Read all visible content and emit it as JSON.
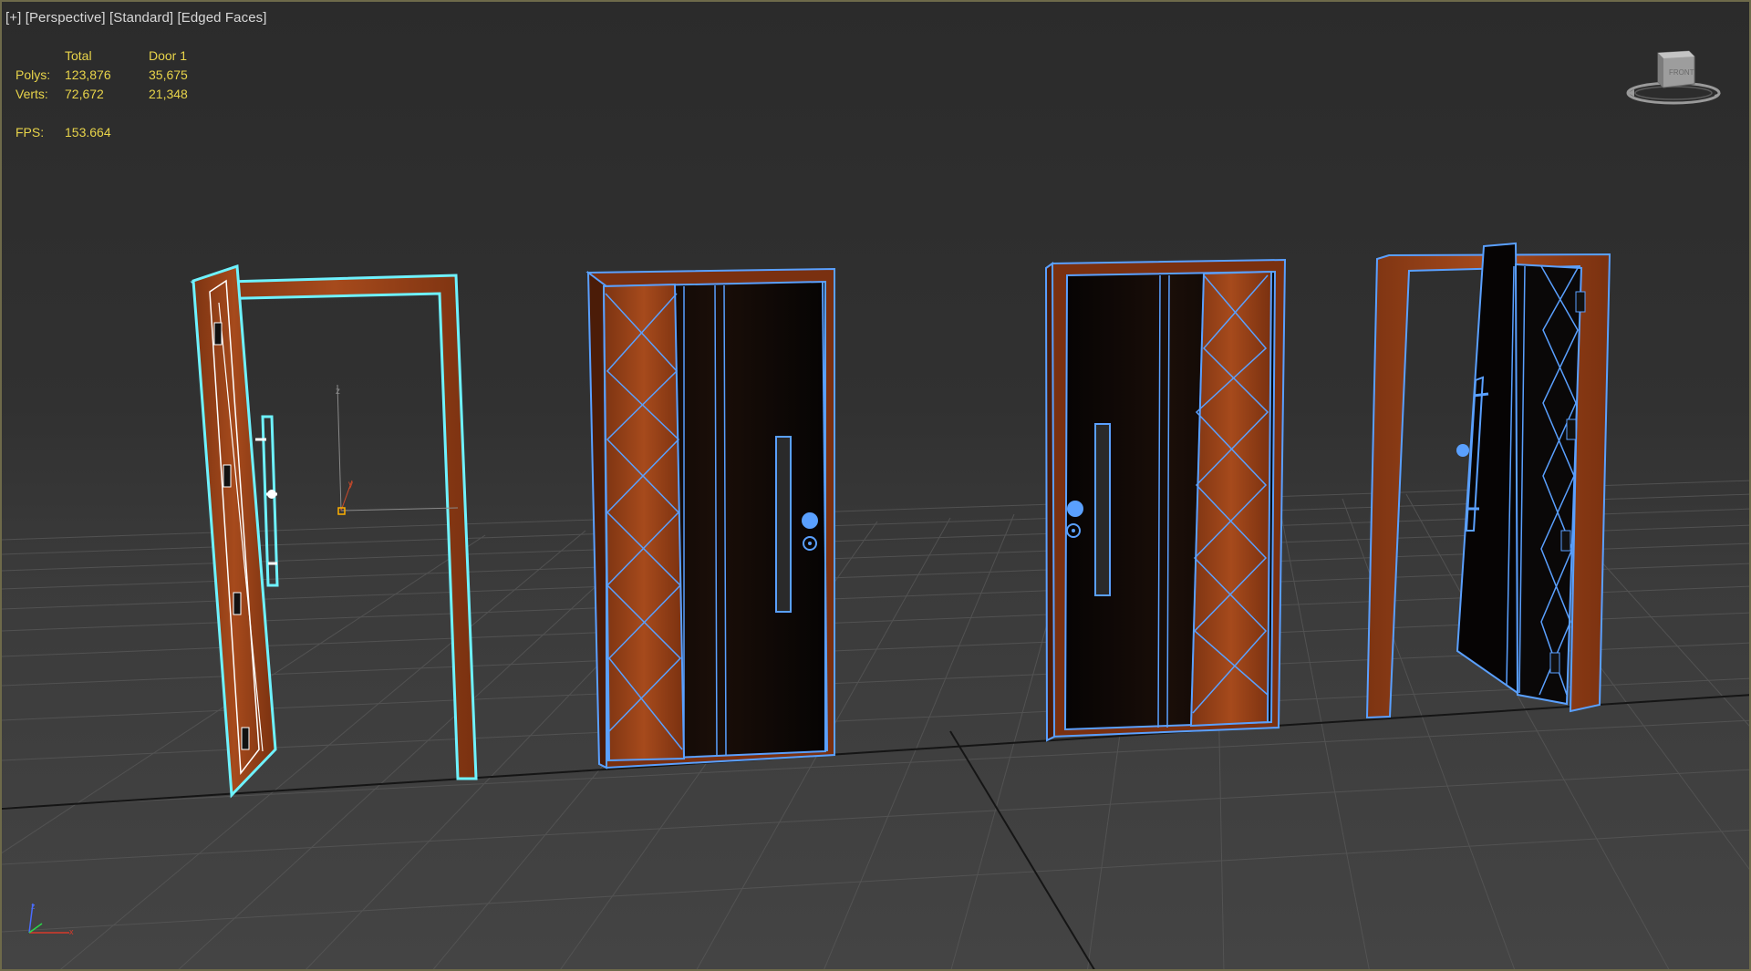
{
  "viewport": {
    "label_parts": [
      "[+]",
      "[Perspective]",
      "[Standard]",
      "[Edged Faces]"
    ]
  },
  "stats": {
    "header": [
      "",
      "Total",
      "Door 1"
    ],
    "polys": [
      "Polys:",
      "123,876",
      "35,675"
    ],
    "verts": [
      "Verts:",
      "72,672",
      "21,348"
    ],
    "fps": [
      "FPS:",
      "153.664"
    ]
  },
  "viewcube": {
    "face_label": "FRONT"
  },
  "colors": {
    "wood": "#8a3a14",
    "wood_light": "#a4491a",
    "dark_panel": "#0b0806",
    "edge": "#5aa0ff",
    "selected": "#6ef2ff",
    "grid": "#565656",
    "stats_text": "#e8d44a"
  },
  "icons": {
    "viewcube": "viewcube-icon",
    "gizmo": "transform-gizmo-icon",
    "tripod": "world-axis-icon"
  }
}
